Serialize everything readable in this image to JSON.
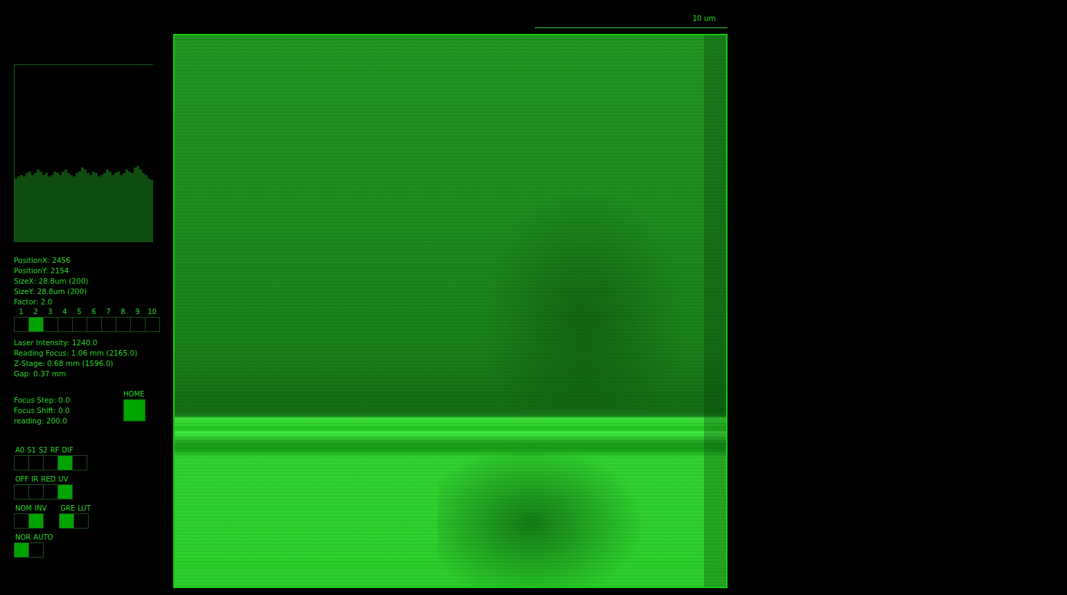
{
  "scale_bar": {
    "label": "10 um"
  },
  "histogram": {
    "values": [
      36,
      37,
      38,
      37,
      39,
      40,
      38,
      39,
      41,
      40,
      38,
      39,
      37,
      38,
      40,
      39,
      38,
      40,
      41,
      39,
      38,
      37,
      39,
      40,
      42,
      41,
      39,
      38,
      40,
      39,
      37,
      38,
      39,
      41,
      40,
      38,
      39,
      40,
      38,
      39,
      41,
      40,
      39,
      42,
      43,
      41,
      39,
      38,
      36,
      35
    ]
  },
  "info": [
    "PositionX: 2456",
    "PositionY: 2154",
    "SizeX: 28.8um (200)",
    "SizeY: 28.8um (200)",
    "Factor: 2.0"
  ],
  "factor_selector": [
    {
      "label": "1",
      "selected": false
    },
    {
      "label": "2",
      "selected": true
    },
    {
      "label": "3",
      "selected": false
    },
    {
      "label": "4",
      "selected": false
    },
    {
      "label": "5",
      "selected": false
    },
    {
      "label": "6",
      "selected": false
    },
    {
      "label": "7",
      "selected": false
    },
    {
      "label": "8",
      "selected": false
    },
    {
      "label": "9",
      "selected": false
    },
    {
      "label": "10",
      "selected": false
    }
  ],
  "laser_info": [
    "Laser Intensity: 1240.0",
    "Reading Focus: 1.06 mm (2165.0)",
    "Z-Stage: 0.68 mm (1596.0)",
    "Gap: 0.37 mm"
  ],
  "focus_info": [
    "Focus Step: 0.0",
    "Focus Shift: 0.0",
    "reading: 200.0"
  ],
  "home_button": {
    "label": "HOME"
  },
  "toggle_rows": [
    [
      {
        "items": [
          {
            "label": "A0",
            "selected": false
          },
          {
            "label": "S1",
            "selected": false
          },
          {
            "label": "S2",
            "selected": false
          },
          {
            "label": "RF",
            "selected": true
          },
          {
            "label": "DIF",
            "selected": false
          }
        ]
      }
    ],
    [
      {
        "items": [
          {
            "label": "OFF",
            "selected": false
          },
          {
            "label": "IR",
            "selected": false
          },
          {
            "label": "RED",
            "selected": false
          },
          {
            "label": "UV",
            "selected": true
          }
        ]
      }
    ],
    [
      {
        "items": [
          {
            "label": "NOM",
            "selected": false
          },
          {
            "label": "INV",
            "selected": true
          }
        ]
      },
      {
        "items": [
          {
            "label": "GRE",
            "selected": true
          },
          {
            "label": "LUT",
            "selected": false
          }
        ]
      }
    ],
    [
      {
        "items": [
          {
            "label": "NOR",
            "selected": true
          },
          {
            "label": "AUTO",
            "selected": false
          }
        ]
      }
    ]
  ]
}
